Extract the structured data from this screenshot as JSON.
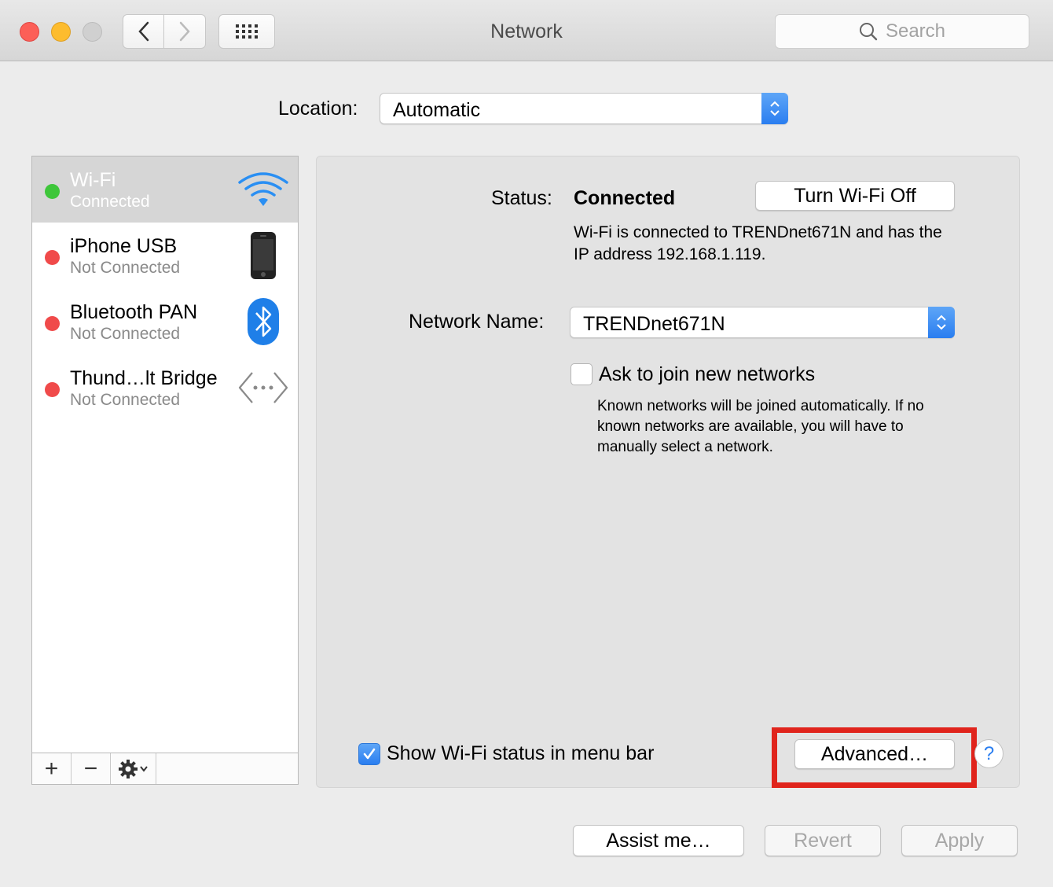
{
  "window": {
    "title": "Network"
  },
  "toolbar": {
    "search_placeholder": "Search"
  },
  "location": {
    "label": "Location:",
    "value": "Automatic"
  },
  "services": [
    {
      "name": "Wi-Fi",
      "status": "Connected",
      "status_color": "#3ec63a",
      "icon": "wifi-icon",
      "selected": true
    },
    {
      "name": "iPhone USB",
      "status": "Not Connected",
      "status_color": "#f04a4a",
      "icon": "iphone-icon",
      "selected": false
    },
    {
      "name": "Bluetooth PAN",
      "status": "Not Connected",
      "status_color": "#f04a4a",
      "icon": "bluetooth-icon",
      "selected": false
    },
    {
      "name": "Thund…lt Bridge",
      "status": "Not Connected",
      "status_color": "#f04a4a",
      "icon": "thunderbolt-bridge-icon",
      "selected": false
    }
  ],
  "sidebar_toolbar": {
    "add": "+",
    "remove": "−"
  },
  "detail": {
    "status_label": "Status:",
    "status_value": "Connected",
    "turn_off_button": "Turn Wi-Fi Off",
    "status_description": "Wi-Fi is connected to TRENDnet671N and has the IP address 192.168.1.119.",
    "network_name_label": "Network Name:",
    "network_name_value": "TRENDnet671N",
    "ask_join_label": "Ask to join new networks",
    "ask_join_checked": false,
    "ask_join_description": "Known networks will be joined automatically. If no known networks are available, you will have to manually select a network.",
    "show_status_label": "Show Wi-Fi status in menu bar",
    "show_status_checked": true,
    "advanced_button": "Advanced…",
    "help_button": "?"
  },
  "footer": {
    "assist_button": "Assist me…",
    "revert_button": "Revert",
    "apply_button": "Apply"
  },
  "colors": {
    "accent": "#2a7ef0",
    "highlight_box": "#e0241c",
    "connected": "#3ec63a",
    "not_connected": "#f04a4a"
  }
}
